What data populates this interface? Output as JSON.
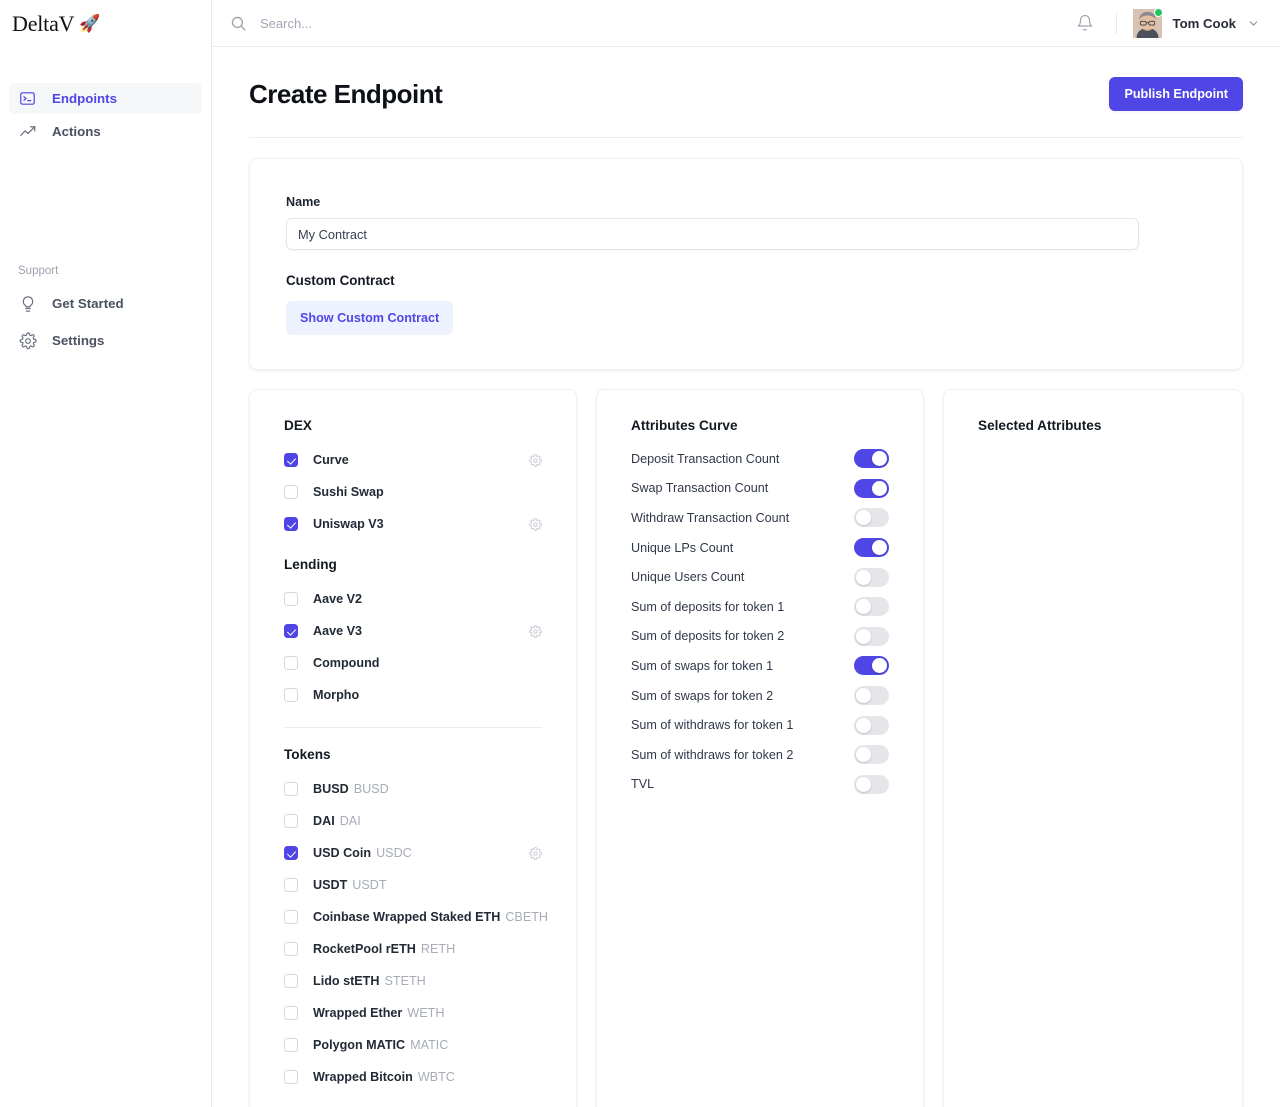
{
  "brand": {
    "name": "DeltaV",
    "rocket": "🚀"
  },
  "sidebar": {
    "items": [
      {
        "label": "Endpoints",
        "icon": "terminal-icon",
        "active": true
      },
      {
        "label": "Actions",
        "icon": "trending-up-icon",
        "active": false
      }
    ],
    "support_heading": "Support",
    "support_items": [
      {
        "label": "Get Started",
        "icon": "lightbulb-icon"
      },
      {
        "label": "Settings",
        "icon": "gear-icon"
      }
    ]
  },
  "topbar": {
    "search_placeholder": "Search...",
    "search_value": "",
    "notifications_icon": "bell-icon",
    "user_name": "Tom Cook",
    "status": "online"
  },
  "page": {
    "title": "Create Endpoint",
    "publish_label": "Publish Endpoint"
  },
  "form": {
    "name_label": "Name",
    "name_value": "My Contract",
    "name_placeholder": "Name",
    "custom_contract_label": "Custom Contract",
    "show_custom_contract_label": "Show Custom Contract"
  },
  "protocols": {
    "dex_title": "DEX",
    "dex": [
      {
        "label": "Curve",
        "checked": true,
        "gear": true
      },
      {
        "label": "Sushi Swap",
        "checked": false,
        "gear": false
      },
      {
        "label": "Uniswap V3",
        "checked": true,
        "gear": true
      }
    ],
    "lending_title": "Lending",
    "lending": [
      {
        "label": "Aave V2",
        "checked": false,
        "gear": false
      },
      {
        "label": "Aave V3",
        "checked": true,
        "gear": true
      },
      {
        "label": "Compound",
        "checked": false,
        "gear": false
      },
      {
        "label": "Morpho",
        "checked": false,
        "gear": false
      }
    ],
    "tokens_title": "Tokens",
    "tokens": [
      {
        "label": "BUSD",
        "symbol": "BUSD",
        "checked": false,
        "gear": false
      },
      {
        "label": "DAI",
        "symbol": "DAI",
        "checked": false,
        "gear": false
      },
      {
        "label": "USD Coin",
        "symbol": "USDC",
        "checked": true,
        "gear": true
      },
      {
        "label": "USDT",
        "symbol": "USDT",
        "checked": false,
        "gear": false
      },
      {
        "label": "Coinbase Wrapped Staked ETH",
        "symbol": "CBETH",
        "checked": false,
        "gear": false
      },
      {
        "label": "RocketPool rETH",
        "symbol": "RETH",
        "checked": false,
        "gear": false
      },
      {
        "label": "Lido stETH",
        "symbol": "STETH",
        "checked": false,
        "gear": false
      },
      {
        "label": "Wrapped Ether",
        "symbol": "WETH",
        "checked": false,
        "gear": false
      },
      {
        "label": "Polygon MATIC",
        "symbol": "MATIC",
        "checked": false,
        "gear": false
      },
      {
        "label": "Wrapped Bitcoin",
        "symbol": "WBTC",
        "checked": false,
        "gear": false
      }
    ]
  },
  "attributes": {
    "title": "Attributes Curve",
    "items": [
      {
        "label": "Deposit Transaction Count",
        "on": true
      },
      {
        "label": "Swap Transaction Count",
        "on": true
      },
      {
        "label": "Withdraw Transaction Count",
        "on": false
      },
      {
        "label": "Unique LPs Count",
        "on": true
      },
      {
        "label": "Unique Users Count",
        "on": false
      },
      {
        "label": "Sum of deposits for token 1",
        "on": false
      },
      {
        "label": "Sum of deposits for token 2",
        "on": false
      },
      {
        "label": "Sum of swaps for token 1",
        "on": true
      },
      {
        "label": "Sum of swaps for token 2",
        "on": false
      },
      {
        "label": "Sum of withdraws for token 1",
        "on": false
      },
      {
        "label": "Sum of withdraws for token 2",
        "on": false
      },
      {
        "label": "TVL",
        "on": false
      }
    ]
  },
  "selected": {
    "title": "Selected Attributes",
    "items": []
  },
  "colors": {
    "accent": "#4f46e5",
    "accent_soft": "#eef2ff",
    "toggle_off": "#e4e6ea",
    "status_online": "#22c55e"
  }
}
